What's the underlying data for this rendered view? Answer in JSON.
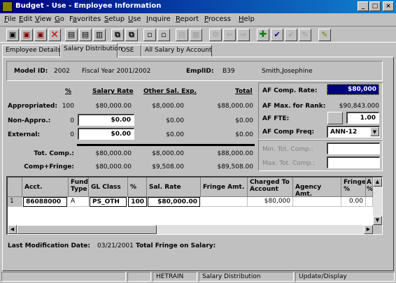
{
  "window": {
    "title": "Budget - Use - Employee Information",
    "minimize": "_",
    "maximize": "□",
    "close": "×"
  },
  "menu": [
    {
      "label": "File",
      "u": "F",
      "rest": "ile"
    },
    {
      "label": "Edit",
      "u": "E",
      "rest": "dit"
    },
    {
      "label": "View",
      "u": "V",
      "rest": "iew"
    },
    {
      "label": "Go",
      "u": "G",
      "rest": "o"
    },
    {
      "label": "Favorites",
      "u": "a",
      "pre": "F",
      "rest": "vorites"
    },
    {
      "label": "Setup",
      "u": "S",
      "rest": "etup"
    },
    {
      "label": "Use",
      "u": "U",
      "rest": "se"
    },
    {
      "label": "Inquire",
      "u": "I",
      "rest": "nquire"
    },
    {
      "label": "Report",
      "u": "R",
      "rest": "eport"
    },
    {
      "label": "Process",
      "u": "P",
      "rest": "rocess"
    },
    {
      "label": "Help",
      "u": "H",
      "rest": "elp"
    }
  ],
  "toolbar": {
    "icons": [
      "save-icon",
      "save-as-icon",
      "save-all-icon",
      "delete-icon",
      "insert-row-icon",
      "delete-row-icon",
      "list-icon",
      "copy-icon",
      "paste-icon",
      "nav-first-icon",
      "nav-last-icon",
      "grid-icon",
      "grid2-icon",
      "settings-icon",
      "back-icon",
      "forward-icon",
      "add-icon",
      "check-icon",
      "check-gray-icon",
      "edit-icon",
      "pencil-icon"
    ]
  },
  "tabs": [
    {
      "label": "Employee Details",
      "active": false
    },
    {
      "label": "Salary Distribution",
      "active": true
    },
    {
      "label": "OSE",
      "active": false
    },
    {
      "label": "All Salary by Account",
      "active": false
    }
  ],
  "header": {
    "model_id_label": "Model ID:",
    "model_id": "2002",
    "fiscal_year": "Fiscal Year 2001/2002",
    "emplid_label": "EmplID:",
    "emplid": "B39",
    "employee_name": "Smith,Josephine"
  },
  "salary": {
    "col_pct": "%",
    "col_salary_rate": "Salary Rate",
    "col_other_sal": "Other Sal. Exp.",
    "col_total": "Total",
    "rows": [
      {
        "label": "Appropriated:",
        "pct": "100",
        "rate": "$80,000.00",
        "other": "$8,000.00",
        "total": "$88,000.00"
      },
      {
        "label": "Non-Appro.:",
        "pct": "0",
        "rate": "$0.00",
        "other": "$0.00",
        "total": "$0.00"
      },
      {
        "label": "External:",
        "pct": "0",
        "rate": "$0.00",
        "other": "$0.00",
        "total": "$0.00"
      }
    ],
    "tot_comp_label": "Tot. Comp.:",
    "tot_comp": {
      "rate": "$80,000.00",
      "other": "$8,000.00",
      "total": "$88,000.00"
    },
    "comp_fringe_label": "Comp+Fringe:",
    "comp_fringe": {
      "rate": "$80,000.00",
      "other": "$9,508.00",
      "total": "$89,508.00"
    }
  },
  "af": {
    "comp_rate_label": "AF Comp. Rate:",
    "comp_rate": "$80,000",
    "max_rank_label": "AF Max. for Rank:",
    "max_rank": "$90,843.000",
    "fte_label": "AF FTE:",
    "fte": "1.00",
    "comp_freq_label": "AF Comp Freq:",
    "comp_freq": "ANN-12",
    "min_tot_label": "Min. Tot. Comp.:",
    "min_tot": "",
    "max_tot_label": "Max. Tot. Comp.:",
    "max_tot": ""
  },
  "grid": {
    "headers": [
      "",
      "Acct.",
      "Fund Type",
      "GL Class",
      "%",
      "Sal. Rate",
      "Fringe Amt.",
      "Charged To Account",
      "Agency Amt.",
      "Fringe %",
      "A %"
    ],
    "rows": [
      {
        "num": "1",
        "acct": "86088000",
        "fund": "A",
        "gl": "PS_OTH",
        "pct": "100",
        "rate": "$80,000.00",
        "fringe": "",
        "charged": "$80,000",
        "agency": "",
        "fringe_pct": "0.00",
        "a_pct": ""
      }
    ]
  },
  "footer": {
    "last_mod_label": "Last Modification Date:",
    "last_mod": "03/21/2001",
    "total_fringe_label": "Total Fringe on Salary:",
    "total_fringe": ""
  },
  "status": {
    "server": "HETRAIN",
    "page": "Salary Distribution",
    "mode": "Update/Display"
  }
}
